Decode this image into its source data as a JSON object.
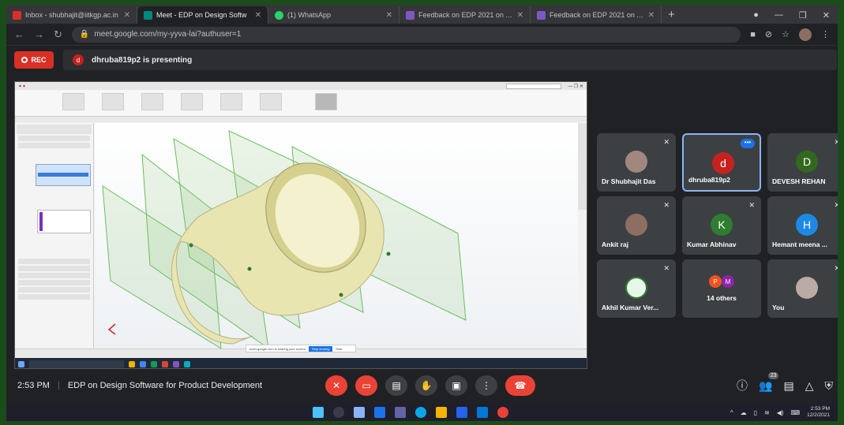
{
  "browser": {
    "tabs": [
      {
        "title": "Inbox - shubhajit@iitkgp.ac.in",
        "color": "#d93025",
        "active": false
      },
      {
        "title": "Meet - EDP on Design Softw",
        "color": "#00897b",
        "active": true
      },
      {
        "title": "(1) WhatsApp",
        "color": "#25d366",
        "active": false
      },
      {
        "title": "Feedback on EDP 2021 on Autod",
        "color": "#7e57c2",
        "active": false
      },
      {
        "title": "Feedback on EDP 2021 on Autod",
        "color": "#7e57c2",
        "active": false
      }
    ],
    "url": "meet.google.com/my-yyva-lai?authuser=1"
  },
  "meet": {
    "rec_label": "REC",
    "presenter_initial": "d",
    "presenting_text": "dhruba819p2 is presenting",
    "share_banner": {
      "text": "meet.google.com is sharing your screen",
      "stop_label": "Stop sharing",
      "hide_label": "Hide"
    }
  },
  "participants": [
    {
      "name": "Dr Shubhajit Das",
      "initial": "",
      "avatar_color": "#a1887f",
      "photo": true
    },
    {
      "name": "dhruba819p2",
      "initial": "d",
      "avatar_color": "#c5221f",
      "highlight": true
    },
    {
      "name": "DEVESH REHAN",
      "initial": "D",
      "avatar_color": "#33691e"
    },
    {
      "name": "Ankit raj",
      "initial": "",
      "avatar_color": "#8d6e63",
      "photo": true
    },
    {
      "name": "Kumar Abhinav",
      "initial": "K",
      "avatar_color": "#2e7d32"
    },
    {
      "name": "Hemant meena ...",
      "initial": "H",
      "avatar_color": "#1e88e5"
    },
    {
      "name": "Akhil Kumar Ver...",
      "initial": "",
      "avatar_color": "#e8f5e9",
      "photo": true
    },
    {
      "name": "14 others",
      "initial": "",
      "others": [
        "P",
        "M"
      ],
      "others_colors": [
        "#f4511e",
        "#8e24aa"
      ]
    },
    {
      "name": "You",
      "initial": "",
      "avatar_color": "#bcaaa4",
      "photo": true
    }
  ],
  "controls": {
    "time": "2:53 PM",
    "meeting_title": "EDP on Design Software for Product Development",
    "participant_count": "23"
  },
  "taskbar": {
    "time": "2:53 PM",
    "date": "12/2/2021"
  }
}
